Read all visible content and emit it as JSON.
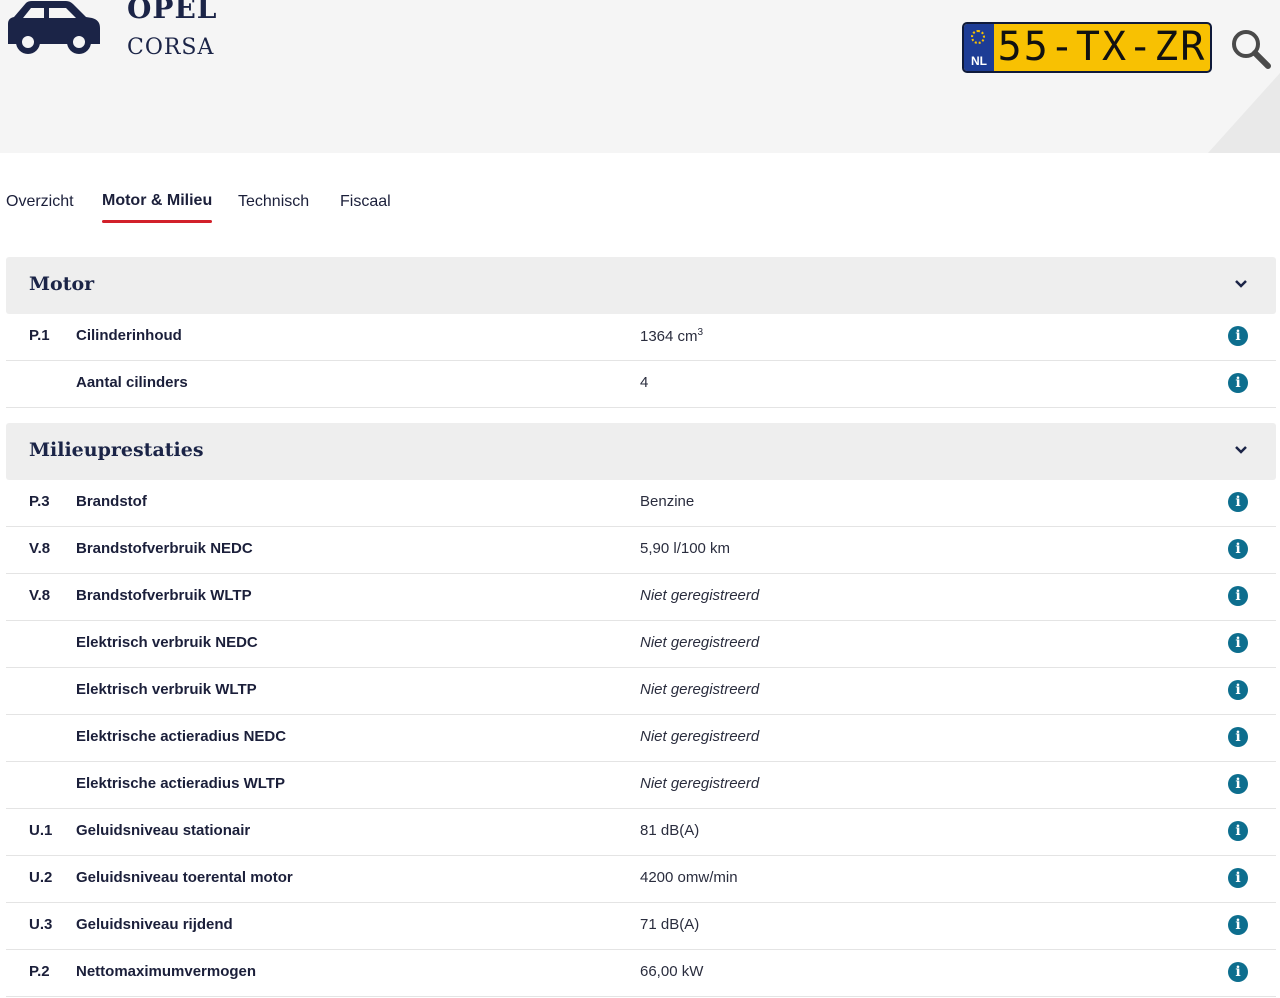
{
  "vehicle": {
    "brand": "OPEL",
    "model": "CORSA",
    "plate_country": "NL",
    "plate_number": "55-TX-ZR"
  },
  "icons": {
    "car": "car-icon",
    "search": "search-icon",
    "chevron": "chevron-down-icon",
    "info": "info-icon"
  },
  "colors": {
    "plate_yellow": "#f8c102",
    "plate_blue": "#1d3c95",
    "active_tab_underline": "#d2202a",
    "info_icon": "#0d6e8e",
    "navy_text": "#1b2447"
  },
  "tabs": [
    {
      "label": "Overzicht",
      "active": false
    },
    {
      "label": "Motor & Milieu",
      "active": true
    },
    {
      "label": "Technisch",
      "active": false
    },
    {
      "label": "Fiscaal",
      "active": false
    }
  ],
  "sections": {
    "motor": {
      "title": "Motor",
      "rows": [
        {
          "code": "P.1",
          "label": "Cilinderinhoud",
          "value": "1364 cm",
          "value_sup": "3",
          "italic": false
        },
        {
          "code": "",
          "label": "Aantal cilinders",
          "value": "4",
          "italic": false
        }
      ]
    },
    "milieu": {
      "title": "Milieuprestaties",
      "rows": [
        {
          "code": "P.3",
          "label": "Brandstof",
          "value": "Benzine",
          "italic": false
        },
        {
          "code": "V.8",
          "label": "Brandstofverbruik NEDC",
          "value": "5,90 l/100 km",
          "italic": false
        },
        {
          "code": "V.8",
          "label": "Brandstofverbruik WLTP",
          "value": "Niet geregistreerd",
          "italic": true
        },
        {
          "code": "",
          "label": "Elektrisch verbruik NEDC",
          "value": "Niet geregistreerd",
          "italic": true
        },
        {
          "code": "",
          "label": "Elektrisch verbruik WLTP",
          "value": "Niet geregistreerd",
          "italic": true
        },
        {
          "code": "",
          "label": "Elektrische actieradius NEDC",
          "value": "Niet geregistreerd",
          "italic": true
        },
        {
          "code": "",
          "label": "Elektrische actieradius WLTP",
          "value": "Niet geregistreerd",
          "italic": true
        },
        {
          "code": "U.1",
          "label": "Geluidsniveau stationair",
          "value": "81 dB(A)",
          "italic": false
        },
        {
          "code": "U.2",
          "label": "Geluidsniveau toerental motor",
          "value": "4200 omw/min",
          "italic": false
        },
        {
          "code": "U.3",
          "label": "Geluidsniveau rijdend",
          "value": "71 dB(A)",
          "italic": false
        },
        {
          "code": "P.2",
          "label": "Nettomaximumvermogen",
          "value": "66,00 kW",
          "italic": false
        }
      ]
    }
  }
}
